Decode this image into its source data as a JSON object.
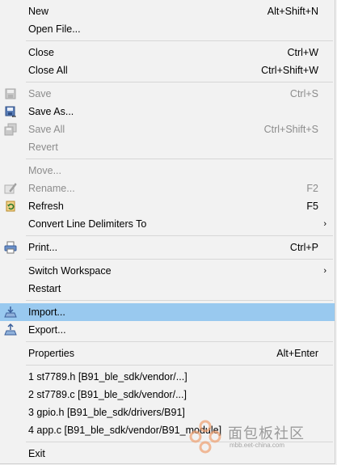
{
  "menu": {
    "new": {
      "label": "New",
      "accel": "Alt+Shift+N"
    },
    "open_file": {
      "label": "Open File..."
    },
    "close": {
      "label": "Close",
      "accel": "Ctrl+W"
    },
    "close_all": {
      "label": "Close All",
      "accel": "Ctrl+Shift+W"
    },
    "save": {
      "label": "Save",
      "accel": "Ctrl+S"
    },
    "save_as": {
      "label": "Save As..."
    },
    "save_all": {
      "label": "Save All",
      "accel": "Ctrl+Shift+S"
    },
    "revert": {
      "label": "Revert"
    },
    "move": {
      "label": "Move..."
    },
    "rename": {
      "label": "Rename...",
      "accel": "F2"
    },
    "refresh": {
      "label": "Refresh",
      "accel": "F5"
    },
    "convert": {
      "label": "Convert Line Delimiters To"
    },
    "print": {
      "label": "Print...",
      "accel": "Ctrl+P"
    },
    "switch_workspace": {
      "label": "Switch Workspace"
    },
    "restart": {
      "label": "Restart"
    },
    "import": {
      "label": "Import..."
    },
    "export": {
      "label": "Export..."
    },
    "properties": {
      "label": "Properties",
      "accel": "Alt+Enter"
    },
    "recent": [
      "1 st7789.h  [B91_ble_sdk/vendor/...]",
      "2 st7789.c  [B91_ble_sdk/vendor/...]",
      "3 gpio.h  [B91_ble_sdk/drivers/B91]",
      "4 app.c  [B91_ble_sdk/vendor/B91_module]"
    ],
    "exit": {
      "label": "Exit"
    }
  },
  "watermark": {
    "text": "面包板社区",
    "sub": "mbb.eet-china.com"
  },
  "colors": {
    "highlight": "#99c9ef",
    "background": "#f2f2f2",
    "disabled_text": "#8c8c8c"
  }
}
